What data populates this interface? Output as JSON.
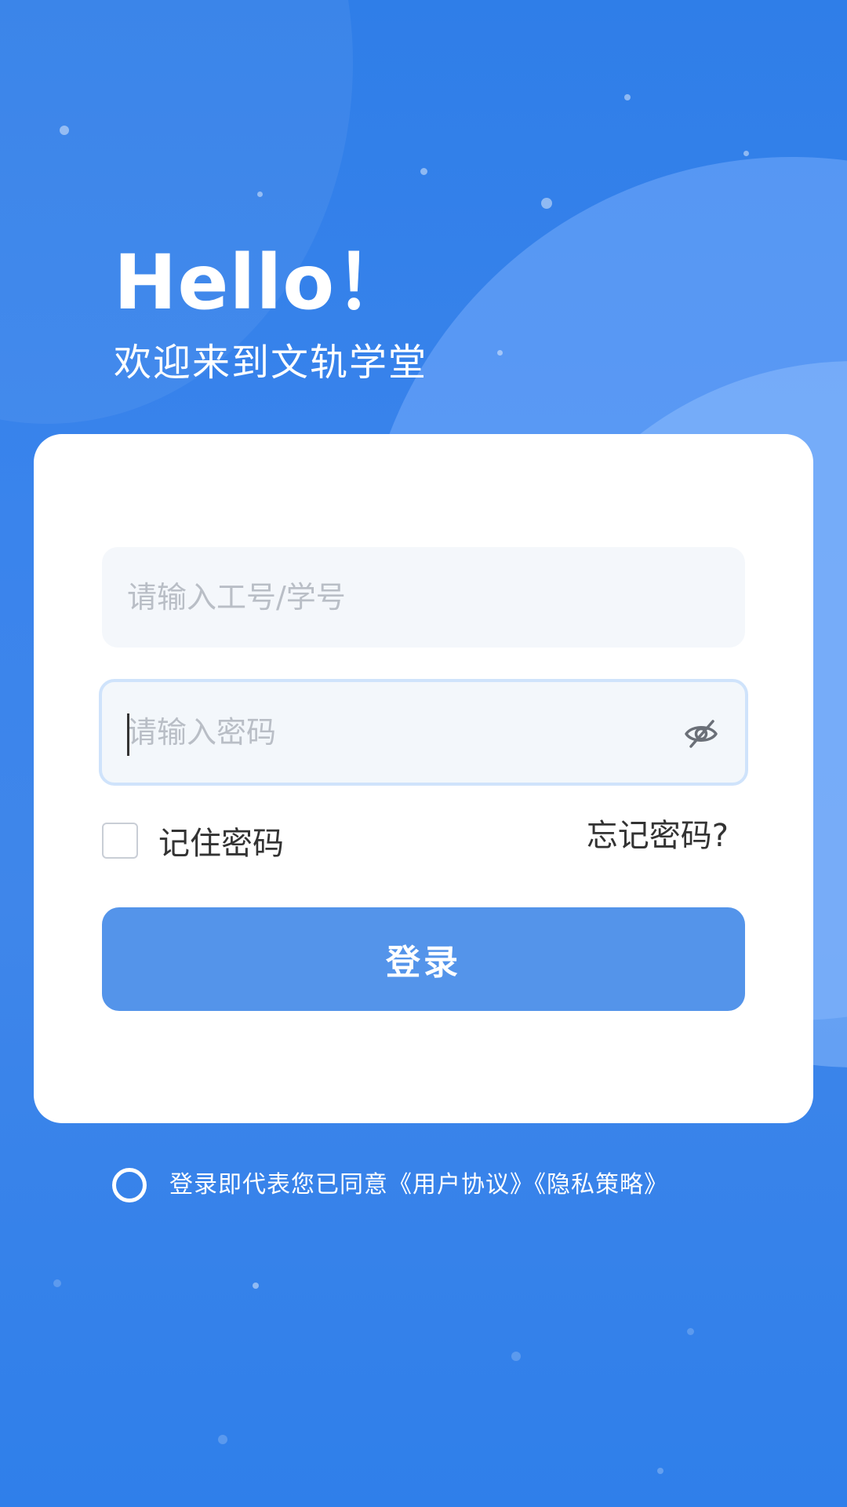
{
  "greeting": {
    "hello": "Hello！",
    "subtitle": "欢迎来到文轨学堂"
  },
  "form": {
    "username_placeholder": "请输入工号/学号",
    "password_placeholder": "请输入密码",
    "remember_label": "记住密码",
    "forgot_label": "忘记密码?",
    "login_label": "登录"
  },
  "agreement": {
    "text": "登录即代表您已同意《用户协议》《隐私策略》"
  },
  "icons": {
    "password_toggle": "eye-off-icon"
  },
  "colors": {
    "background": "#2f7ee8",
    "primary_button": "#5494ea",
    "input_bg": "#f4f7fb",
    "focus_border": "#cfe3fb"
  }
}
